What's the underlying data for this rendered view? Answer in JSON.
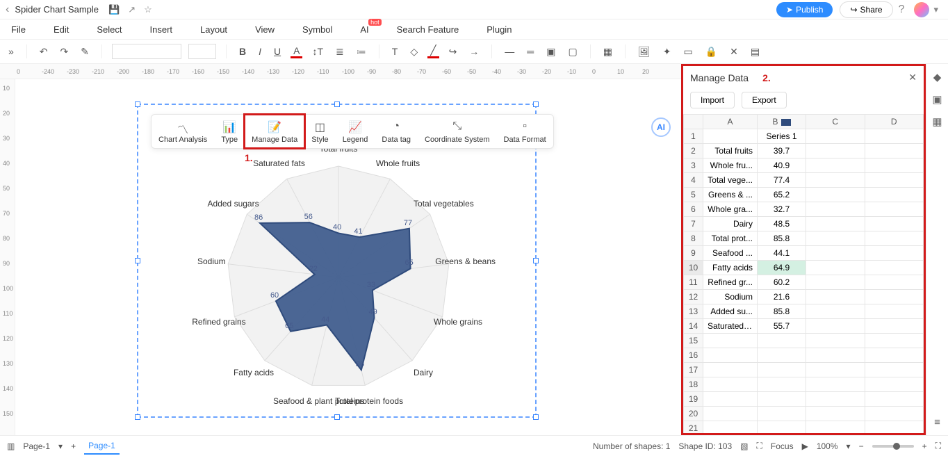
{
  "titlebar": {
    "title": "Spider Chart Sample",
    "publish": "Publish",
    "share": "Share"
  },
  "menubar": {
    "file": "File",
    "edit": "Edit",
    "select": "Select",
    "insert": "Insert",
    "layout": "Layout",
    "view": "View",
    "symbol": "Symbol",
    "ai": "AI",
    "ai_hot": "hot",
    "search": "Search Feature",
    "plugin": "Plugin"
  },
  "chart_toolbar": {
    "analysis": "Chart Analysis",
    "type": "Type",
    "manage": "Manage Data",
    "style": "Style",
    "legend": "Legend",
    "datatag": "Data tag",
    "coord": "Coordinate System",
    "format": "Data Format"
  },
  "annotations": {
    "one": "1.",
    "two": "2."
  },
  "right_panel": {
    "title": "Manage Data",
    "import": "Import",
    "export": "Export"
  },
  "grid": {
    "cols": [
      "A",
      "B",
      "C",
      "D"
    ],
    "series_header": "Series 1",
    "rows": [
      {
        "n": "1",
        "a": "",
        "b": "Series 1"
      },
      {
        "n": "2",
        "a": "Total fruits",
        "b": "39.7"
      },
      {
        "n": "3",
        "a": "Whole fru...",
        "b": "40.9"
      },
      {
        "n": "4",
        "a": "Total vege...",
        "b": "77.4"
      },
      {
        "n": "5",
        "a": "Greens & ...",
        "b": "65.2"
      },
      {
        "n": "6",
        "a": "Whole gra...",
        "b": "32.7"
      },
      {
        "n": "7",
        "a": "Dairy",
        "b": "48.5"
      },
      {
        "n": "8",
        "a": "Total prot...",
        "b": "85.8"
      },
      {
        "n": "9",
        "a": "Seafood ...",
        "b": "44.1"
      },
      {
        "n": "10",
        "a": "Fatty acids",
        "b": "64.9",
        "sel": true
      },
      {
        "n": "11",
        "a": "Refined gr...",
        "b": "60.2"
      },
      {
        "n": "12",
        "a": "Sodium",
        "b": "21.6"
      },
      {
        "n": "13",
        "a": "Added su...",
        "b": "85.8"
      },
      {
        "n": "14",
        "a": "Saturated ...",
        "b": "55.7"
      },
      {
        "n": "15",
        "a": "",
        "b": ""
      },
      {
        "n": "16",
        "a": "",
        "b": ""
      },
      {
        "n": "17",
        "a": "",
        "b": ""
      },
      {
        "n": "18",
        "a": "",
        "b": ""
      },
      {
        "n": "19",
        "a": "",
        "b": ""
      },
      {
        "n": "20",
        "a": "",
        "b": ""
      },
      {
        "n": "21",
        "a": "",
        "b": ""
      }
    ]
  },
  "chart_data": {
    "type": "radar",
    "title": "",
    "categories": [
      "Total fruits",
      "Whole fruits",
      "Total vegetables",
      "Greens & beans",
      "Whole grains",
      "Dairy",
      "Total protein foods",
      "Seafood & plant proteins",
      "Fatty acids",
      "Refined grains",
      "Sodium",
      "Added sugars",
      "Saturated fats"
    ],
    "series": [
      {
        "name": "Series 1",
        "values": [
          39.7,
          40.9,
          77.4,
          65.2,
          32.7,
          48.5,
          85.8,
          44.1,
          64.9,
          60.2,
          21.6,
          85.8,
          55.7
        ]
      }
    ],
    "max": 100
  },
  "radar_labels": {
    "total_fruits": "Total fruits",
    "whole_fruits": "Whole fruits",
    "total_vegetables": "Total vegetables",
    "greens_beans": "Greens & beans",
    "whole_grains": "Whole grains",
    "dairy": "Dairy",
    "total_protein": "Total protein foods",
    "seafood": "Seafood & plant proteins",
    "fatty_acids": "Fatty acids",
    "refined_grains": "Refined grains",
    "sodium": "Sodium",
    "added_sugars": "Added sugars",
    "saturated_fats": "Saturated fats"
  },
  "radar_values": {
    "v56": "56",
    "v86": "86",
    "v77": "77",
    "v41": "41",
    "v40": "40",
    "v65": "65",
    "v33": "33",
    "v49": "49",
    "v44": "44",
    "v86b": "86",
    "v65b": "65",
    "v60": "60",
    "v22": "22"
  },
  "ruler_h": [
    "0",
    "-240",
    "-230",
    "-210",
    "-200",
    "-180",
    "-170",
    "-160",
    "-150",
    "-140",
    "-130",
    "-120",
    "-110",
    "-100",
    "-90",
    "-80",
    "-70",
    "-60",
    "-50",
    "-40",
    "-30",
    "-20",
    "-10",
    "0",
    "10",
    "20"
  ],
  "ruler_v": [
    "10",
    "20",
    "30",
    "40",
    "50",
    "70",
    "80",
    "90",
    "100",
    "110",
    "120",
    "130",
    "140",
    "150"
  ],
  "footer": {
    "page_sel": "Page-1",
    "page_tab": "Page-1",
    "shapes": "Number of shapes: 1",
    "shape_id": "Shape ID: 103",
    "focus": "Focus",
    "zoom": "100%"
  }
}
